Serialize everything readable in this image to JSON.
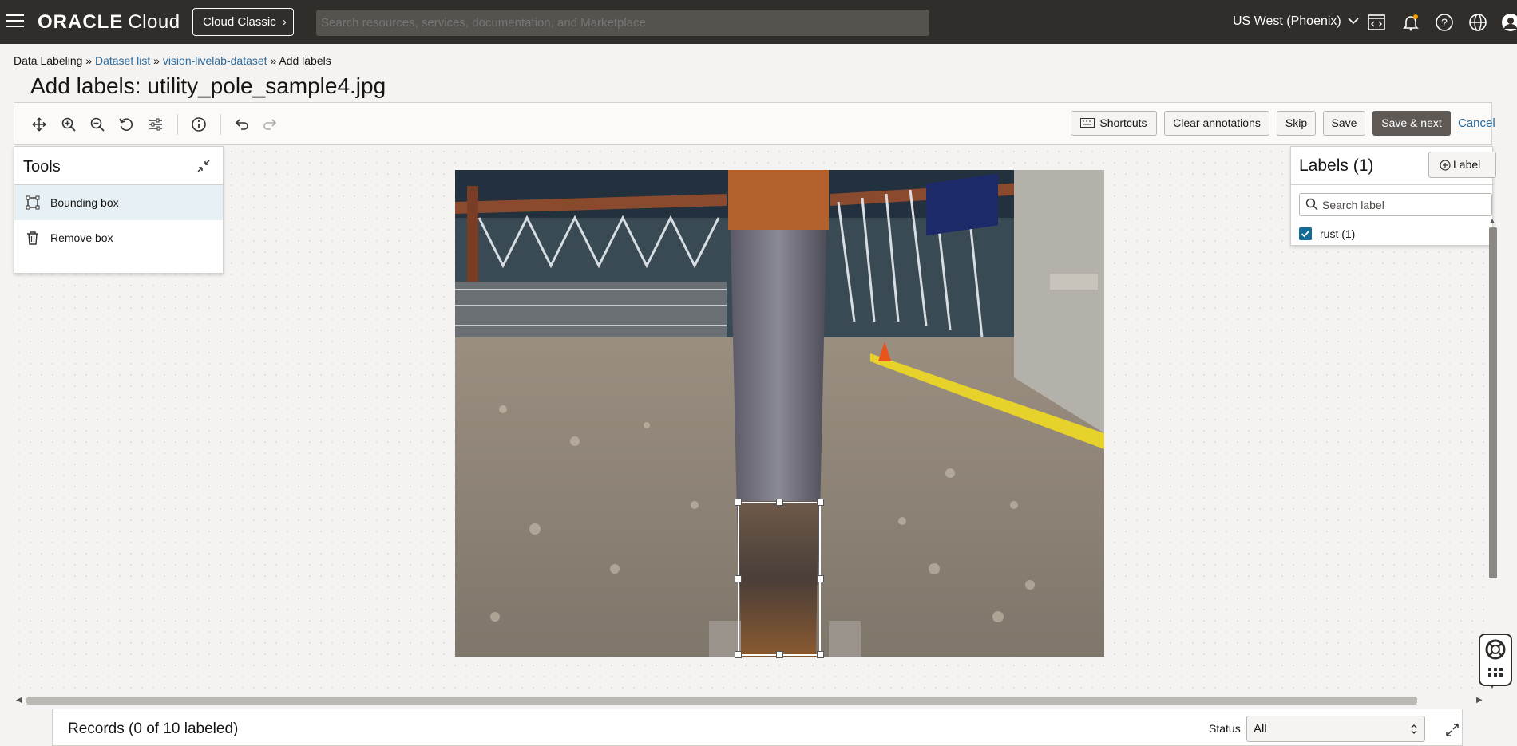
{
  "header": {
    "brand_bold": "ORACLE",
    "brand_cloud": "Cloud",
    "cloud_classic_label": "Cloud Classic",
    "search_placeholder": "Search resources, services, documentation, and Marketplace",
    "region": "US West (Phoenix)",
    "icons": [
      "code-editor-icon",
      "bell-icon",
      "help-icon",
      "globe-icon",
      "profile-icon"
    ]
  },
  "breadcrumb": {
    "items": [
      "Data Labeling",
      "Dataset list",
      "vision-livelab-dataset",
      "Add labels"
    ],
    "separator": "»"
  },
  "page": {
    "title": "Add labels: utility_pole_sample4.jpg"
  },
  "toolbar": {
    "icons": [
      "move-icon",
      "zoom-in-icon",
      "zoom-out-icon",
      "reset-icon",
      "adjust-icon",
      "info-icon",
      "undo-icon",
      "redo-icon"
    ],
    "shortcuts_label": "Shortcuts",
    "clear_label": "Clear annotations",
    "skip_label": "Skip",
    "save_label": "Save",
    "save_next_label": "Save & next",
    "cancel_label": "Cancel"
  },
  "tools": {
    "title": "Tools",
    "items": [
      {
        "label": "Bounding box",
        "icon": "bounding-box-icon",
        "active": true
      },
      {
        "label": "Remove box",
        "icon": "trash-icon",
        "active": false
      }
    ]
  },
  "labels": {
    "title": "Labels (1)",
    "add_label": "Label",
    "search_placeholder": "Search label",
    "items": [
      {
        "label": "rust (1)",
        "checked": true
      }
    ]
  },
  "records": {
    "title": "Records (0 of 10 labeled)",
    "status_label": "Status",
    "status_value": "All"
  },
  "colors": {
    "header_bg": "#312d2a",
    "link": "#2a6a9e",
    "primary_button": "#5e5955",
    "checkbox": "#146b96",
    "active_tool_bg": "#e7f1f5"
  }
}
